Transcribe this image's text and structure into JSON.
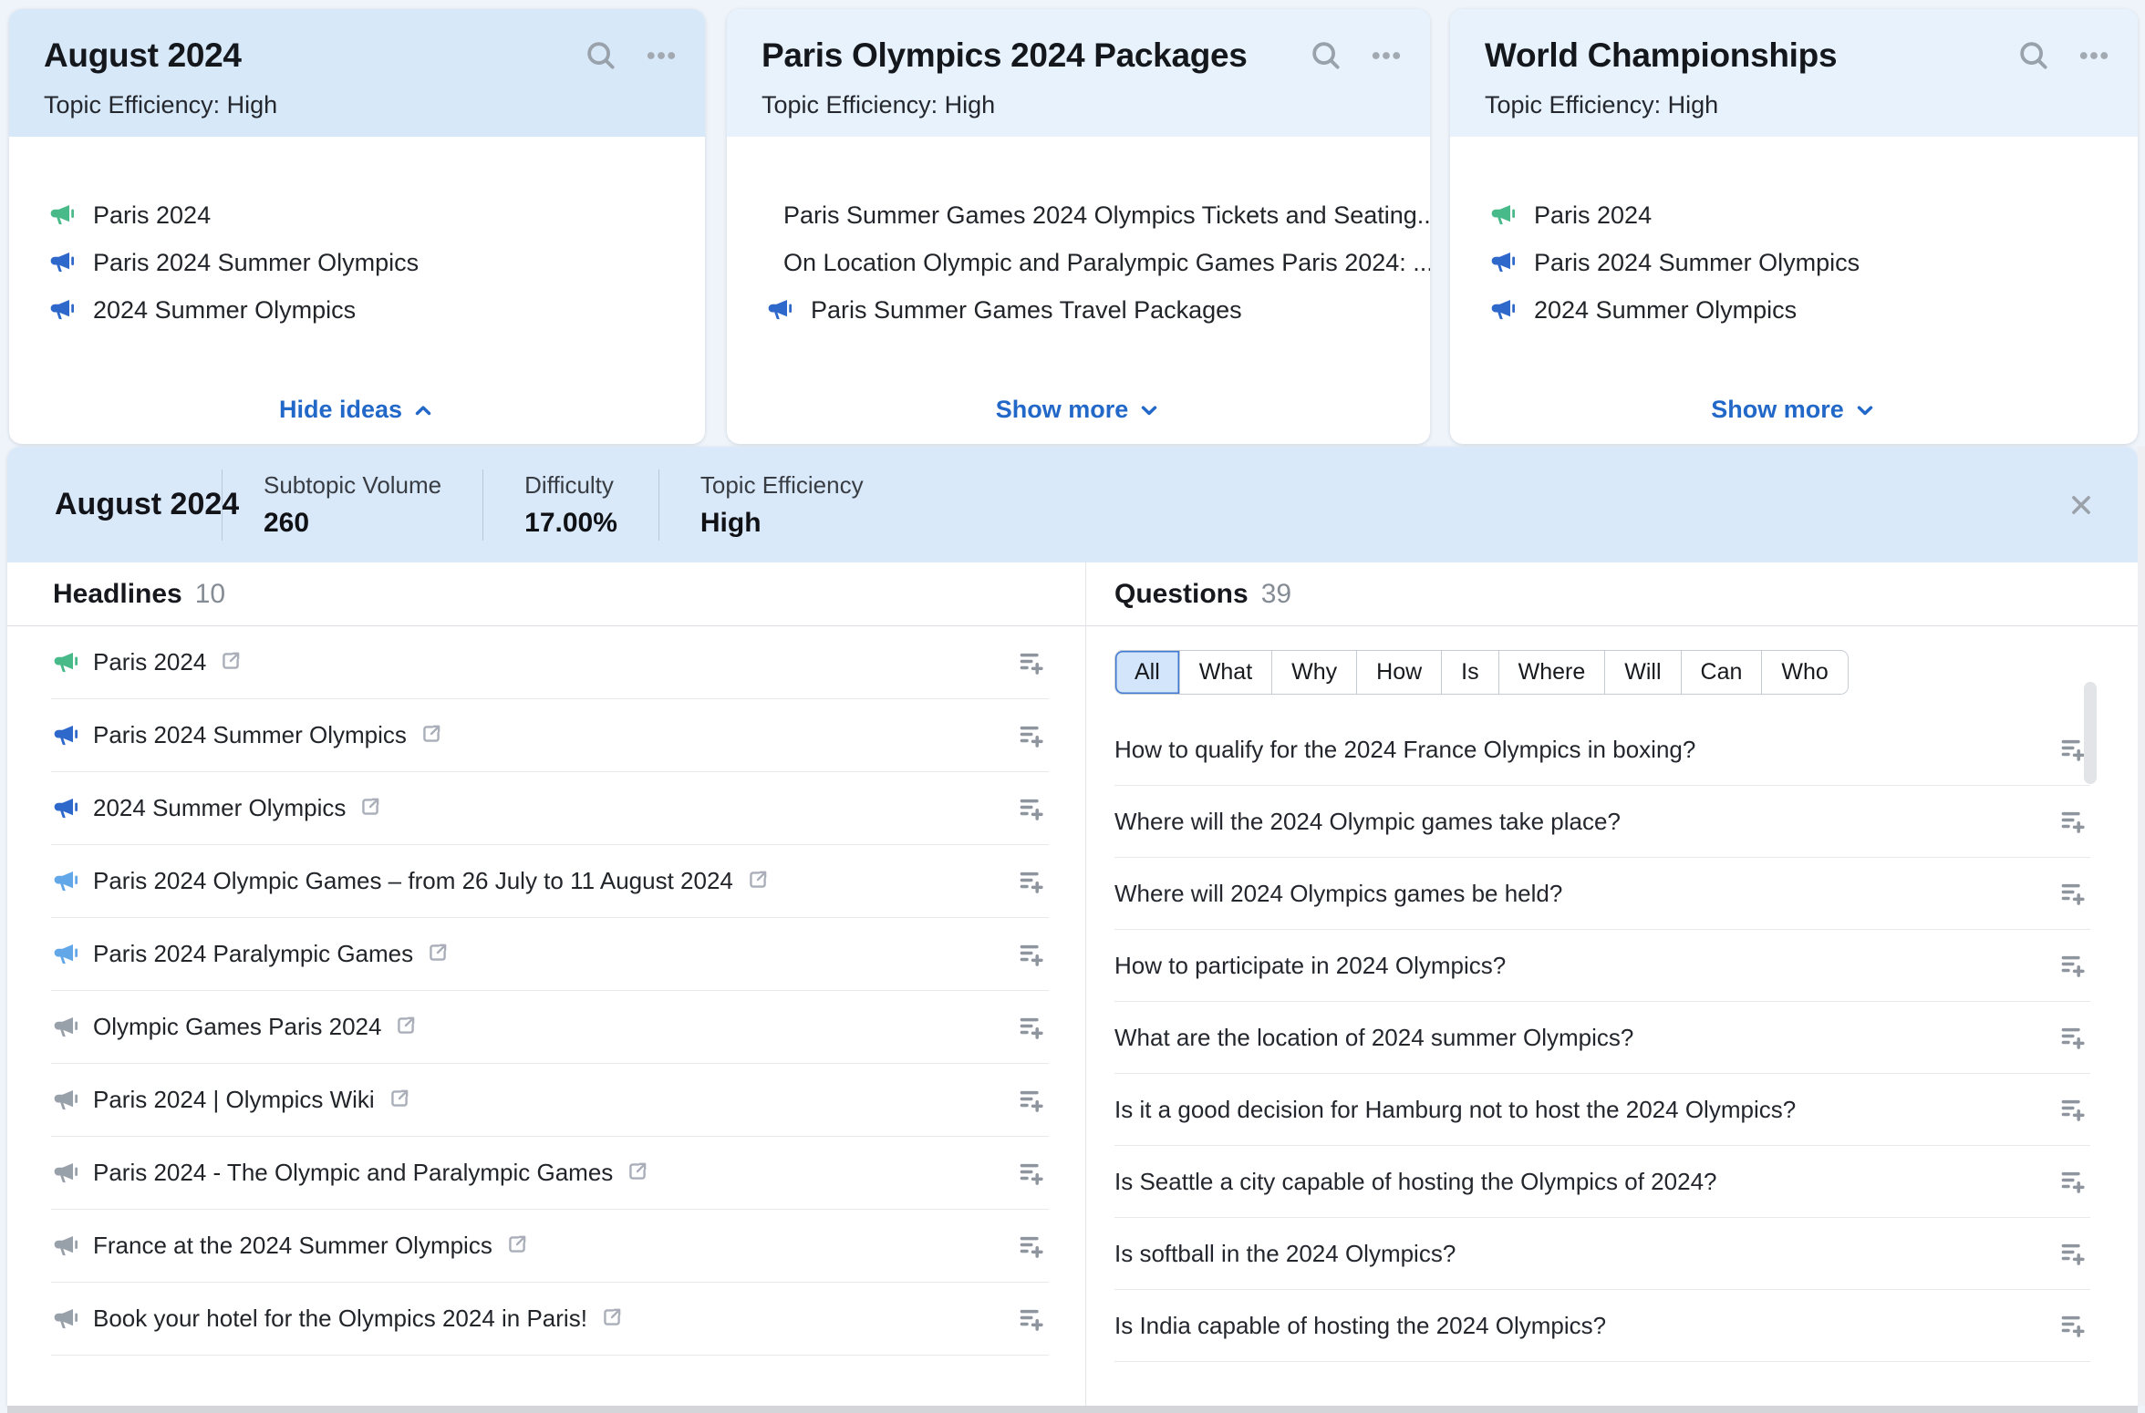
{
  "cards": [
    {
      "title": "August 2024",
      "subtitle": "Topic Efficiency: High",
      "selected": true,
      "items": [
        {
          "icon": "green-megaphone",
          "text": "Paris 2024"
        },
        {
          "icon": "blue-megaphone",
          "text": "Paris 2024 Summer Olympics"
        },
        {
          "icon": "blue-megaphone",
          "text": "2024 Summer Olympics"
        }
      ],
      "footer": "Hide ideas",
      "footer_icon": "chevron-up"
    },
    {
      "title": "Paris Olympics 2024 Packages",
      "subtitle": "Topic Efficiency: High",
      "selected": false,
      "items": [
        {
          "icon": "green-megaphone",
          "text": "Paris Summer Games 2024 Olympics Tickets and Seating..."
        },
        {
          "icon": "blue-megaphone",
          "text": "On Location Olympic and Paralympic Games Paris 2024: ..."
        },
        {
          "icon": "blue-megaphone",
          "text": "Paris Summer Games Travel Packages"
        }
      ],
      "footer": "Show more",
      "footer_icon": "chevron-down"
    },
    {
      "title": "World Championships",
      "subtitle": "Topic Efficiency: High",
      "selected": false,
      "items": [
        {
          "icon": "green-megaphone",
          "text": "Paris 2024"
        },
        {
          "icon": "blue-megaphone",
          "text": "Paris 2024 Summer Olympics"
        },
        {
          "icon": "blue-megaphone",
          "text": "2024 Summer Olympics"
        }
      ],
      "footer": "Show more",
      "footer_icon": "chevron-down"
    }
  ],
  "detail_bar": {
    "title": "August 2024",
    "metrics": [
      {
        "label": "Subtopic Volume",
        "value": "260"
      },
      {
        "label": "Difficulty",
        "value": "17.00%"
      },
      {
        "label": "Topic Efficiency",
        "value": "High"
      }
    ]
  },
  "headlines": {
    "title": "Headlines",
    "count": "10",
    "items": [
      {
        "icon": "green-megaphone",
        "text": "Paris 2024"
      },
      {
        "icon": "blue-megaphone",
        "text": "Paris 2024 Summer Olympics"
      },
      {
        "icon": "blue-megaphone",
        "text": "2024 Summer Olympics"
      },
      {
        "icon": "lightblue-megaphone",
        "text": "Paris 2024 Olympic Games – from 26 July to 11 August 2024"
      },
      {
        "icon": "lightblue-megaphone",
        "text": "Paris 2024 Paralympic Games"
      },
      {
        "icon": "gray-megaphone",
        "text": "Olympic Games Paris 2024"
      },
      {
        "icon": "gray-megaphone",
        "text": "Paris 2024 | Olympics Wiki"
      },
      {
        "icon": "gray-megaphone",
        "text": "Paris 2024 - The Olympic and Paralympic Games"
      },
      {
        "icon": "gray-megaphone",
        "text": "France at the 2024 Summer Olympics"
      },
      {
        "icon": "gray-megaphone",
        "text": "Book your hotel for the Olympics 2024 in Paris!"
      }
    ]
  },
  "questions": {
    "title": "Questions",
    "count": "39",
    "filters": [
      {
        "label": "All",
        "active": true
      },
      {
        "label": "What",
        "active": false
      },
      {
        "label": "Why",
        "active": false
      },
      {
        "label": "How",
        "active": false
      },
      {
        "label": "Is",
        "active": false
      },
      {
        "label": "Where",
        "active": false
      },
      {
        "label": "Will",
        "active": false
      },
      {
        "label": "Can",
        "active": false
      },
      {
        "label": "Who",
        "active": false
      }
    ],
    "items": [
      "How to qualify for the 2024 France Olympics in boxing?",
      "Where will the 2024 Olympic games take place?",
      "Where will 2024 Olympics games be held?",
      "How to participate in 2024 Olympics?",
      "What are the location of 2024 summer Olympics?",
      "Is it a good decision for Hamburg not to host the 2024 Olympics?",
      "Is Seattle a city capable of hosting the Olympics of 2024?",
      "Is softball in the 2024 Olympics?",
      "Is India capable of hosting the 2024 Olympics?"
    ]
  },
  "colors": {
    "selected_card_header": "#d7e8f9",
    "card_header": "#e7f2fc",
    "detail_bar": "#d9e9fa",
    "link_blue": "#2268c8",
    "megaphone_green": "#48b988",
    "megaphone_blue": "#2e68cb",
    "megaphone_lightblue": "#62a7e8",
    "megaphone_gray": "#98a1aa",
    "active_pill_bg": "#d3e5fb",
    "active_pill_border": "#3f79d2"
  }
}
